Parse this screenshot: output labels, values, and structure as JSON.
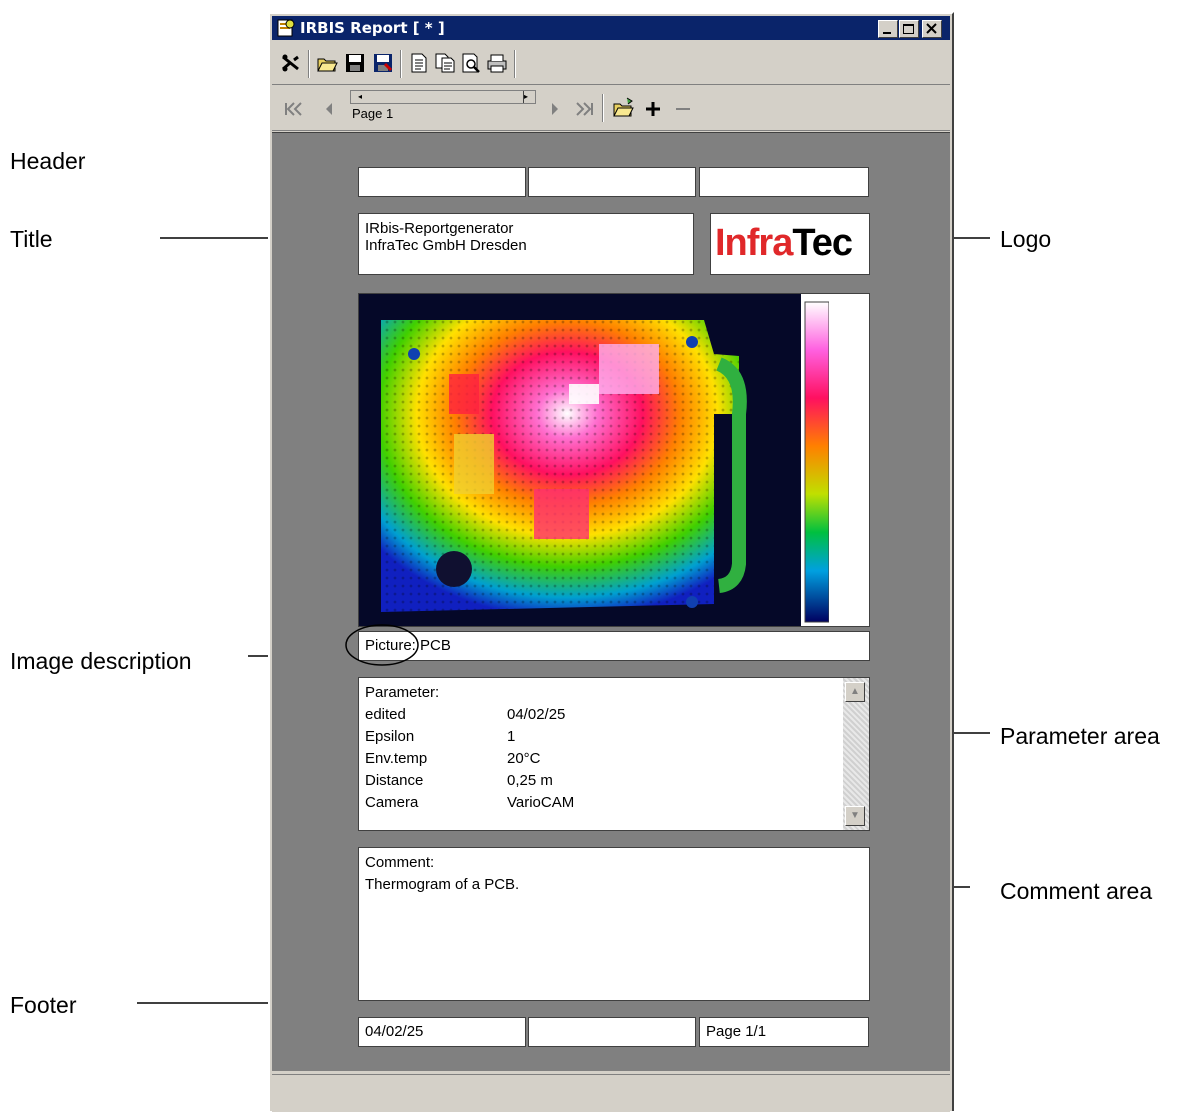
{
  "window": {
    "title": "IRBIS Report [ * ]"
  },
  "navigation": {
    "page_label": "Page 1"
  },
  "annotations": {
    "header": "Header",
    "title": "Title",
    "logo": "Logo",
    "image_description": "Image description",
    "parameter_area": "Parameter area",
    "comment_area": "Comment area",
    "footer": "Footer"
  },
  "report": {
    "title_line1": "IRbis-Reportgenerator",
    "title_line2": "InfraTec GmbH Dresden",
    "logo_part1": "Infra",
    "logo_part2": "Tec",
    "picture_caption": "Picture: PCB",
    "parameters": {
      "heading": "Parameter:",
      "rows": [
        {
          "name": "edited",
          "value": "04/02/25"
        },
        {
          "name": "Epsilon",
          "value": "1"
        },
        {
          "name": "Env.temp",
          "value": "20°C"
        },
        {
          "name": "Distance",
          "value": "0,25 m"
        },
        {
          "name": "Camera",
          "value": "VarioCAM"
        }
      ]
    },
    "comment": {
      "heading": "Comment:",
      "text": "Thermogram of a PCB."
    },
    "footer": {
      "left": "04/02/25",
      "middle": "",
      "right": "Page 1/1"
    }
  },
  "colors": {
    "logo_red": "#e0282a",
    "logo_black": "#000000",
    "titlebar": "#0a246a"
  }
}
